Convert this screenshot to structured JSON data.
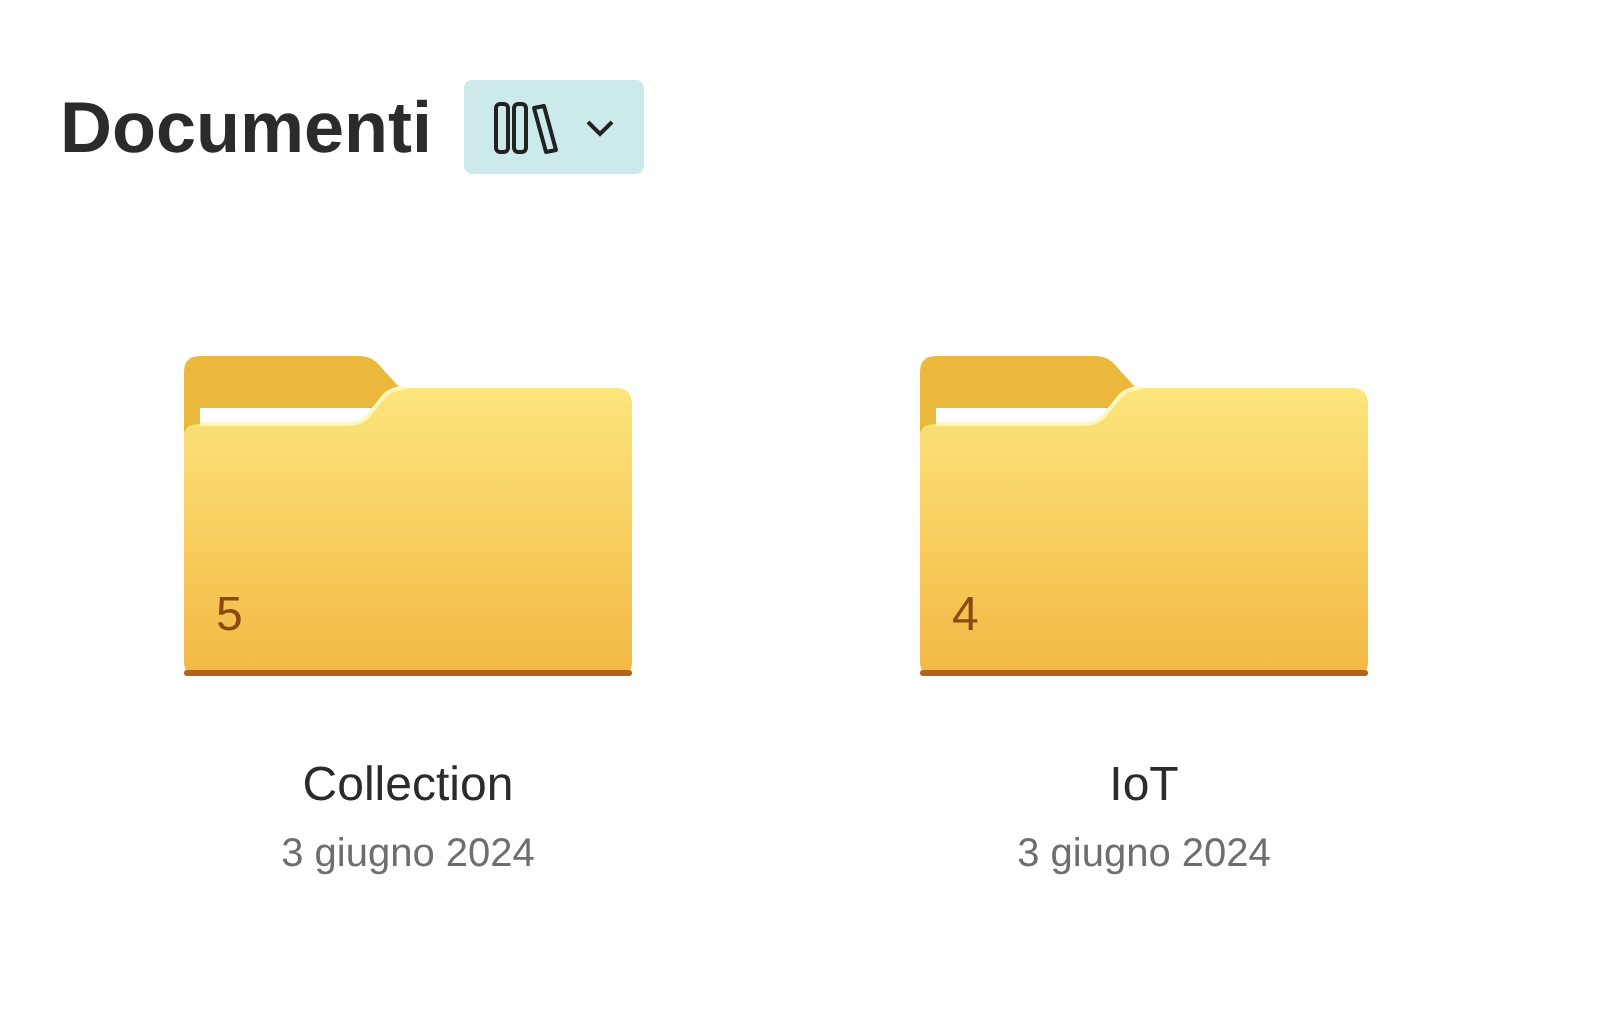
{
  "title": "Documenti",
  "view_button": {
    "expanded": false
  },
  "folders": [
    {
      "count": "5",
      "name": "Collection",
      "date": "3 giugno 2024"
    },
    {
      "count": "4",
      "name": "IoT",
      "date": "3 giugno 2024"
    }
  ]
}
